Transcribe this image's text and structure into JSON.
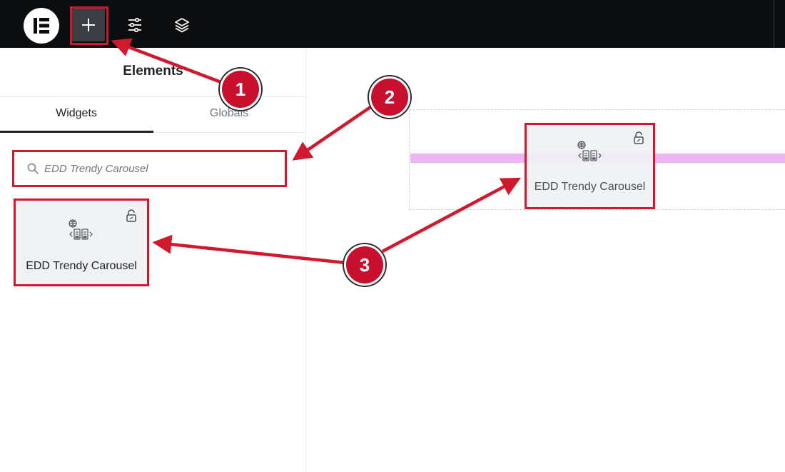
{
  "toolbar": {
    "logo_icon": "elementor-logo-icon",
    "add_icon": "plus-icon",
    "settings_icon": "sliders-icon",
    "layers_icon": "layers-icon"
  },
  "panel": {
    "title": "Elements",
    "tabs": [
      {
        "label": "Widgets",
        "active": true
      },
      {
        "label": "Globals",
        "active": false
      }
    ],
    "search": {
      "value": "",
      "placeholder": "EDD Trendy Carousel"
    },
    "widgets": [
      {
        "label": "EDD Trendy Carousel",
        "icon": "carousel-icon",
        "locked": true
      }
    ]
  },
  "canvas": {
    "dragged_widget": {
      "label": "EDD Trendy Carousel",
      "icon": "carousel-icon",
      "locked": true
    },
    "drop_indicator_color": "#efb4f5"
  },
  "annotations": {
    "badges": [
      "1",
      "2",
      "3"
    ],
    "color": "#c8102e"
  }
}
